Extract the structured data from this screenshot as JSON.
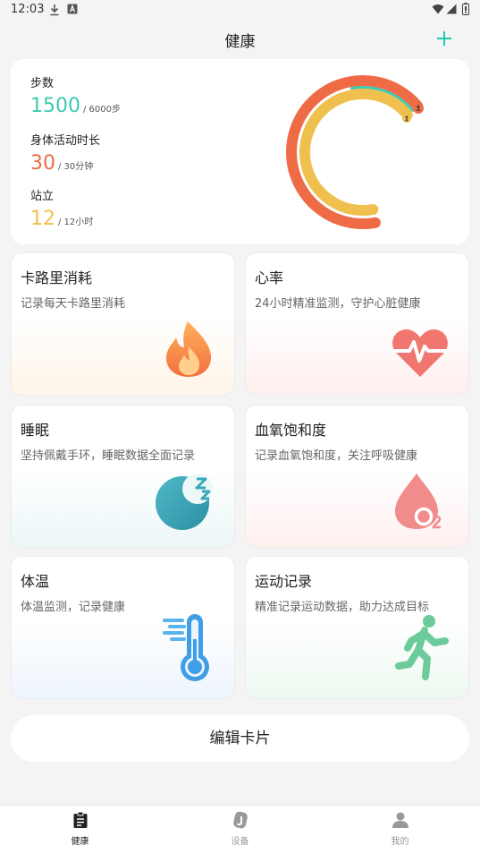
{
  "status_bar": {
    "time": "12:03"
  },
  "header": {
    "title": "健康"
  },
  "summary": {
    "steps": {
      "label": "步数",
      "value": "1500",
      "goal": "/ 6000步"
    },
    "activity": {
      "label": "身体活动时长",
      "value": "30",
      "goal": "/ 30分钟"
    },
    "stand": {
      "label": "站立",
      "value": "12",
      "goal": "/ 12小时"
    },
    "rings": {
      "activity_fraction": 1.0,
      "stand_fraction": 1.0,
      "steps_fraction": 0.25
    }
  },
  "colors": {
    "accent": "#1ccbaf",
    "steps": "#3ccbb2",
    "activity": "#ef6b45",
    "stand": "#f0c04e"
  },
  "cards": [
    {
      "title": "卡路里消耗",
      "desc": "记录每天卡路里消耗",
      "icon": "flame-icon"
    },
    {
      "title": "心率",
      "desc": "24小时精准监测，守护心脏健康",
      "icon": "heart-rate-icon"
    },
    {
      "title": "睡眠",
      "desc": "坚持佩戴手环，睡眠数据全面记录",
      "icon": "moon-sleep-icon"
    },
    {
      "title": "血氧饱和度",
      "desc": "记录血氧饱和度，关注呼吸健康",
      "icon": "blood-drop-o2-icon"
    },
    {
      "title": "体温",
      "desc": "体温监测，记录健康",
      "icon": "thermometer-icon"
    },
    {
      "title": "运动记录",
      "desc": "精准记录运动数据，助力达成目标",
      "icon": "running-person-icon"
    }
  ],
  "edit_button": {
    "label": "编辑卡片"
  },
  "nav": [
    {
      "label": "健康",
      "icon": "clipboard-icon",
      "active": true
    },
    {
      "label": "设备",
      "icon": "watch-icon",
      "active": false
    },
    {
      "label": "我的",
      "icon": "person-icon",
      "active": false
    }
  ]
}
